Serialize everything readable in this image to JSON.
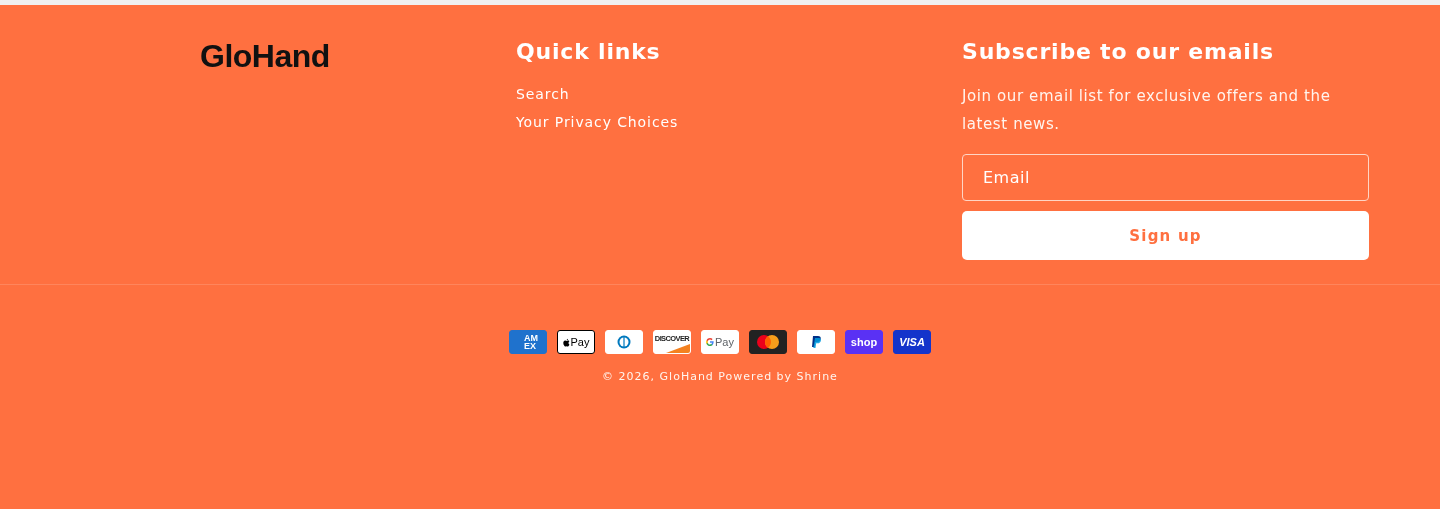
{
  "brand": {
    "logo": "GloHand"
  },
  "quick_links": {
    "heading": "Quick links",
    "links": [
      "Search",
      "Your Privacy Choices"
    ]
  },
  "newsletter": {
    "heading": "Subscribe to our emails",
    "text": "Join our email list for exclusive offers and the latest news.",
    "email_placeholder": "Email",
    "button": "Sign up"
  },
  "payment_methods": [
    {
      "kind": "amex",
      "label": "AMEX"
    },
    {
      "kind": "applepay",
      "label": "Pay"
    },
    {
      "kind": "diners"
    },
    {
      "kind": "discover",
      "label": "DISCOVER"
    },
    {
      "kind": "googlepay",
      "label": "Pay"
    },
    {
      "kind": "mastercard"
    },
    {
      "kind": "paypal"
    },
    {
      "kind": "shoppay",
      "label": "shop"
    },
    {
      "kind": "visa",
      "label": "VISA"
    }
  ],
  "copyright": {
    "text": "© 2026,",
    "brand_link": "GloHand",
    "powered_by": "Powered by Shrine"
  }
}
